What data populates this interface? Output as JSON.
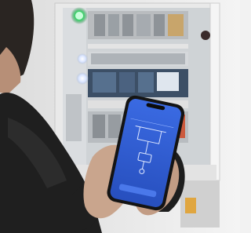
{
  "photo": {
    "subject": "person-holding-smartphone-in-front-of-electrical-panel"
  },
  "phone_screen": {
    "header_line_1": "",
    "header_line_2": "",
    "device_label": ""
  },
  "colors": {
    "screen_blue": "#2f5fd6",
    "cabinet_white": "#e9e9e9",
    "status_light_green": "#3bd36a",
    "jacket_dark": "#1f1f1f",
    "skin": "#c9a58d"
  }
}
